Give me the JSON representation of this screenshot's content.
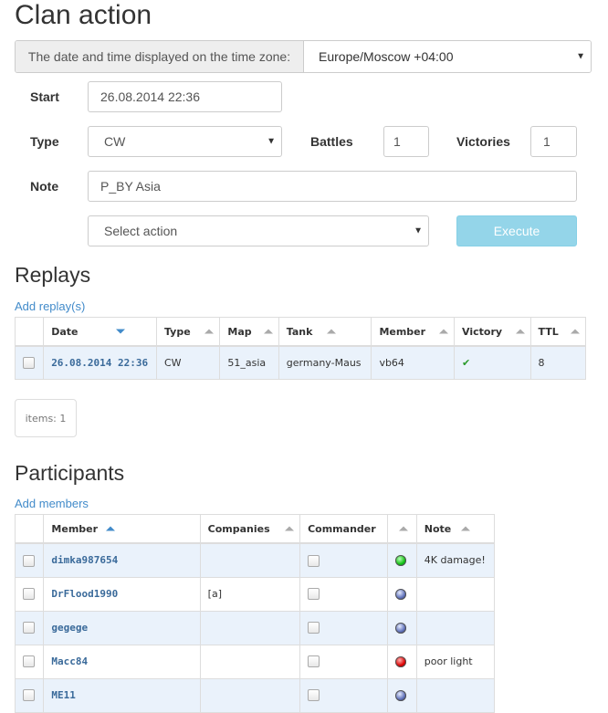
{
  "page_title": "Clan action",
  "timezone": {
    "label": "The date and time displayed on the time zone:",
    "value": "Europe/Moscow +04:00"
  },
  "form": {
    "start_label": "Start",
    "start_value": "26.08.2014 22:36",
    "type_label": "Type",
    "type_value": "CW",
    "battles_label": "Battles",
    "battles_value": "1",
    "victories_label": "Victories",
    "victories_value": "1",
    "note_label": "Note",
    "note_value": "P_BY Asia",
    "action_placeholder": "Select action",
    "execute_label": "Execute"
  },
  "replays": {
    "heading": "Replays",
    "add_link": "Add replay(s)",
    "columns": [
      "Date",
      "Type",
      "Map",
      "Tank",
      "Member",
      "Victory",
      "TTL"
    ],
    "rows": [
      {
        "date": "26.08.2014 22:36",
        "type": "CW",
        "map": "51_asia",
        "tank": "germany-Maus",
        "member": "vb64",
        "victory": "✔",
        "ttl": "8"
      }
    ],
    "items_count": "items: 1"
  },
  "participants": {
    "heading": "Participants",
    "add_link": "Add members",
    "columns": [
      "Member",
      "Companies",
      "Commander",
      "",
      "Note"
    ],
    "rows": [
      {
        "member": "dimka987654",
        "companies": "",
        "status": "green",
        "note": "4K damage!"
      },
      {
        "member": "DrFlood1990",
        "companies": "[a]",
        "status": "blue",
        "note": ""
      },
      {
        "member": "gegege",
        "companies": "",
        "status": "blue",
        "note": ""
      },
      {
        "member": "Macc84",
        "companies": "",
        "status": "red",
        "note": "poor light"
      },
      {
        "member": "ME11",
        "companies": "",
        "status": "blue",
        "note": ""
      }
    ]
  }
}
